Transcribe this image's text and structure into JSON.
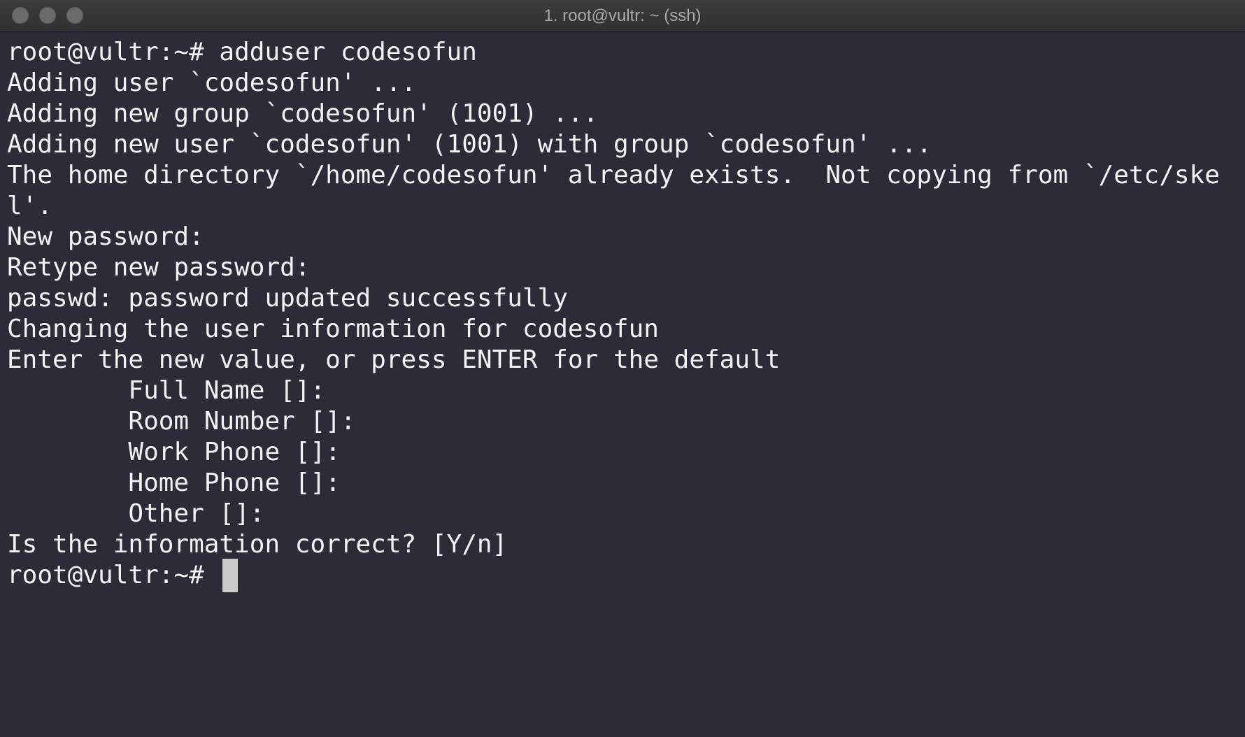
{
  "window": {
    "title": "1. root@vultr: ~ (ssh)"
  },
  "terminal": {
    "lines": [
      "root@vultr:~# adduser codesofun",
      "Adding user `codesofun' ...",
      "Adding new group `codesofun' (1001) ...",
      "Adding new user `codesofun' (1001) with group `codesofun' ...",
      "The home directory `/home/codesofun' already exists.  Not copying from `/etc/ske",
      "l'.",
      "New password:",
      "Retype new password:",
      "passwd: password updated successfully",
      "Changing the user information for codesofun",
      "Enter the new value, or press ENTER for the default",
      "\tFull Name []:",
      "\tRoom Number []:",
      "\tWork Phone []:",
      "\tHome Phone []:",
      "\tOther []:",
      "Is the information correct? [Y/n]",
      "root@vultr:~# "
    ]
  },
  "colors": {
    "background": "#2a2d38",
    "foreground": "#f2f2f2",
    "cursor": "#c9c9c9"
  }
}
